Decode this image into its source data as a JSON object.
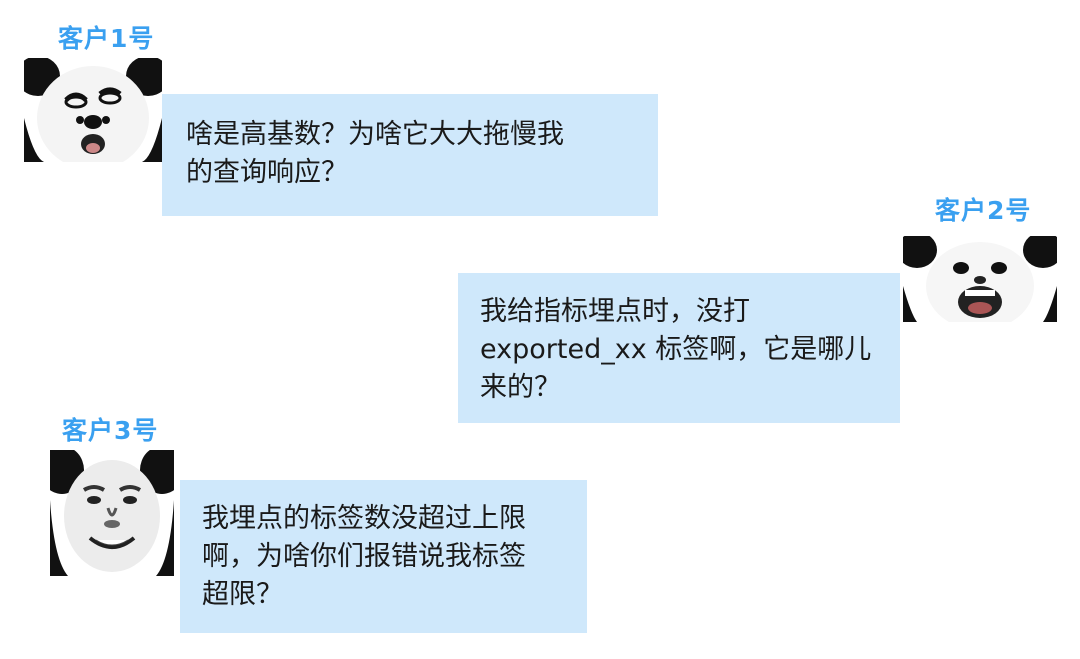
{
  "messages": [
    {
      "sender": "客户1号",
      "avatar_icon": "panda-meme-face-icon",
      "lines": [
        "啥是高基数？为啥它大大拖慢我",
        "的查询响应？"
      ]
    },
    {
      "sender": "客户2号",
      "avatar_icon": "panda-meme-face-icon",
      "lines": [
        "我给指标埋点时，没打",
        "exported_xx 标签啊，它是哪儿",
        "来的？"
      ]
    },
    {
      "sender": "客户3号",
      "avatar_icon": "panda-meme-face-icon",
      "lines": [
        "我埋点的标签数没超过上限",
        "啊，为啥你们报错说我标签",
        "超限？"
      ]
    }
  ],
  "colors": {
    "sender_name": "#3aa0f0",
    "bubble_background": "#cfe8fb",
    "text": "#1a1a1a"
  }
}
